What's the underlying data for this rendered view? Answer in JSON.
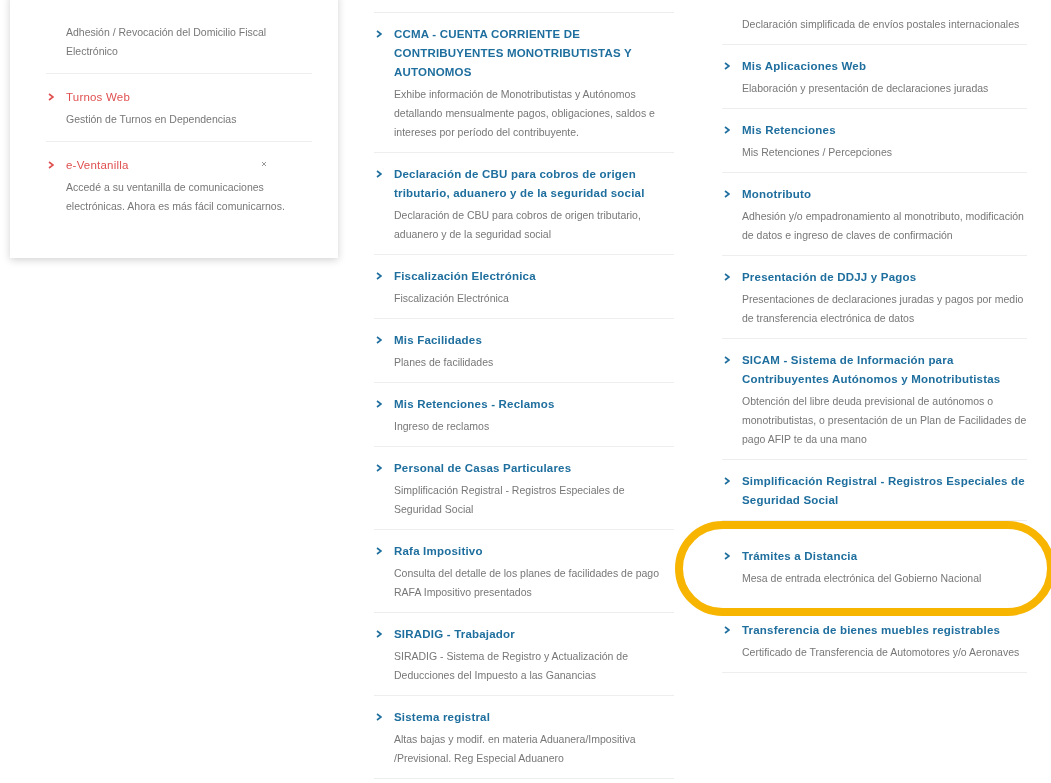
{
  "left_card": {
    "items": [
      {
        "description": "Adhesión / Revocación del Domicilio Fiscal Electrónico"
      },
      {
        "title": "Turnos Web",
        "description": "Gestión de Turnos en Dependencias"
      },
      {
        "title": "e-Ventanilla",
        "description": "Accedé a su ventanilla de comunicaciones electrónicas. Ahora es más fácil comunicarnos."
      }
    ]
  },
  "middle_column": {
    "items": [
      {
        "title": "CCMA - CUENTA CORRIENTE DE CONTRIBUYENTES MONOTRIBUTISTAS Y AUTONOMOS",
        "description": "Exhibe información de Monotributistas y Autónomos detallando mensualmente pagos, obligaciones, saldos e intereses por período del contribuyente."
      },
      {
        "title": "Declaración de CBU para cobros de origen tributario, aduanero y de la seguridad social",
        "description": "Declaración de CBU para cobros de origen tributario, aduanero y de la seguridad social"
      },
      {
        "title": "Fiscalización Electrónica",
        "description": "Fiscalización Electrónica"
      },
      {
        "title": "Mis Facilidades",
        "description": "Planes de facilidades"
      },
      {
        "title": "Mis Retenciones - Reclamos",
        "description": "Ingreso de reclamos"
      },
      {
        "title": "Personal de Casas Particulares",
        "description": "Simplificación Registral - Registros Especiales de Seguridad Social"
      },
      {
        "title": "Rafa Impositivo",
        "description": "Consulta del detalle de los planes de facilidades de pago RAFA Impositivo presentados"
      },
      {
        "title": "SIRADIG - Trabajador",
        "description": "SIRADIG - Sistema de Registro y Actualización de Deducciones del Impuesto a las Ganancias"
      },
      {
        "title": "Sistema registral",
        "description": "Altas bajas y modif. en materia Aduanera/Impositiva /Previsional. Reg Especial Aduanero"
      }
    ]
  },
  "right_column": {
    "items": [
      {
        "description": "Declaración simplificada de envíos postales internacionales",
        "highlighted": false
      },
      {
        "title": "Mis Aplicaciones Web",
        "description": "Elaboración y presentación de declaraciones juradas",
        "highlighted": false
      },
      {
        "title": "Mis Retenciones",
        "description": "Mis Retenciones / Percepciones",
        "highlighted": false
      },
      {
        "title": "Monotributo",
        "description": "Adhesión y/o empadronamiento al monotributo, modificación de datos e ingreso de claves de confirmación",
        "highlighted": false
      },
      {
        "title": "Presentación de DDJJ y Pagos",
        "description": "Presentaciones de declaraciones juradas y pagos por medio de transferencia electrónica de datos",
        "highlighted": false
      },
      {
        "title": "SICAM - Sistema de Información para Contribuyentes Autónomos y Monotributistas",
        "description": "Obtención del libre deuda previsional de autónomos o monotributistas, o presentación de un Plan de Facilidades de pago AFIP te da una mano",
        "highlighted": false
      },
      {
        "title": "Simplificación Registral - Registros Especiales de Seguridad Social",
        "highlighted": false
      },
      {
        "title": "Trámites a Distancia",
        "description": "Mesa de entrada electrónica del Gobierno Nacional",
        "highlighted": true
      },
      {
        "title": "Transferencia de bienes muebles registrables",
        "description": "Certificado de Transferencia de Automotores y/o Aeronaves",
        "highlighted": false
      }
    ]
  }
}
